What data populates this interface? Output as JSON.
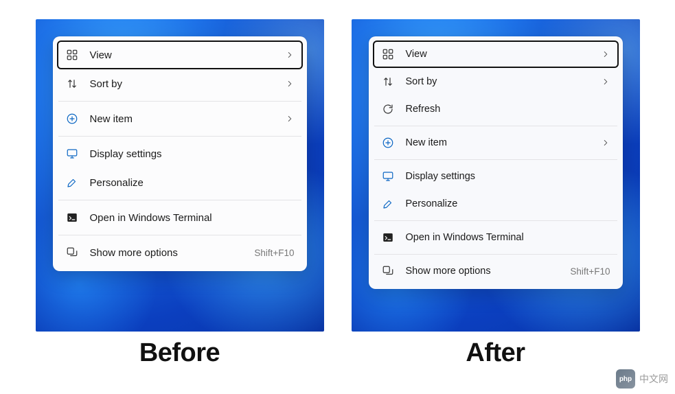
{
  "captions": {
    "before": "Before",
    "after": "After"
  },
  "before_menu": {
    "items": [
      {
        "id": "view",
        "label": "View",
        "icon": "grid-icon",
        "has_submenu": true,
        "focused": true
      },
      {
        "id": "sort",
        "label": "Sort by",
        "icon": "sort-icon",
        "has_submenu": true
      },
      {
        "divider": true
      },
      {
        "id": "new",
        "label": "New item",
        "icon": "plus-circle-icon",
        "icon_color": "blue",
        "has_submenu": true
      },
      {
        "divider": true
      },
      {
        "id": "display",
        "label": "Display settings",
        "icon": "display-icon",
        "icon_color": "blue"
      },
      {
        "id": "personalize",
        "label": "Personalize",
        "icon": "brush-icon",
        "icon_color": "blue"
      },
      {
        "divider": true
      },
      {
        "id": "terminal",
        "label": "Open in Windows Terminal",
        "icon": "terminal-icon"
      },
      {
        "divider": true
      },
      {
        "id": "more",
        "label": "Show more options",
        "icon": "more-options-icon",
        "shortcut": "Shift+F10"
      }
    ]
  },
  "after_menu": {
    "items": [
      {
        "id": "view",
        "label": "View",
        "icon": "grid-icon",
        "has_submenu": true,
        "focused": true
      },
      {
        "id": "sort",
        "label": "Sort by",
        "icon": "sort-icon",
        "has_submenu": true
      },
      {
        "id": "refresh",
        "label": "Refresh",
        "icon": "refresh-icon"
      },
      {
        "divider": true
      },
      {
        "id": "new",
        "label": "New item",
        "icon": "plus-circle-icon",
        "icon_color": "blue",
        "has_submenu": true
      },
      {
        "divider": true
      },
      {
        "id": "display",
        "label": "Display settings",
        "icon": "display-icon",
        "icon_color": "blue"
      },
      {
        "id": "personalize",
        "label": "Personalize",
        "icon": "brush-icon",
        "icon_color": "blue"
      },
      {
        "divider": true
      },
      {
        "id": "terminal",
        "label": "Open in Windows Terminal",
        "icon": "terminal-icon"
      },
      {
        "divider": true
      },
      {
        "id": "more",
        "label": "Show more options",
        "icon": "more-options-icon",
        "shortcut": "Shift+F10"
      }
    ]
  },
  "watermark": {
    "logo_text": "php",
    "text": "中文网"
  }
}
